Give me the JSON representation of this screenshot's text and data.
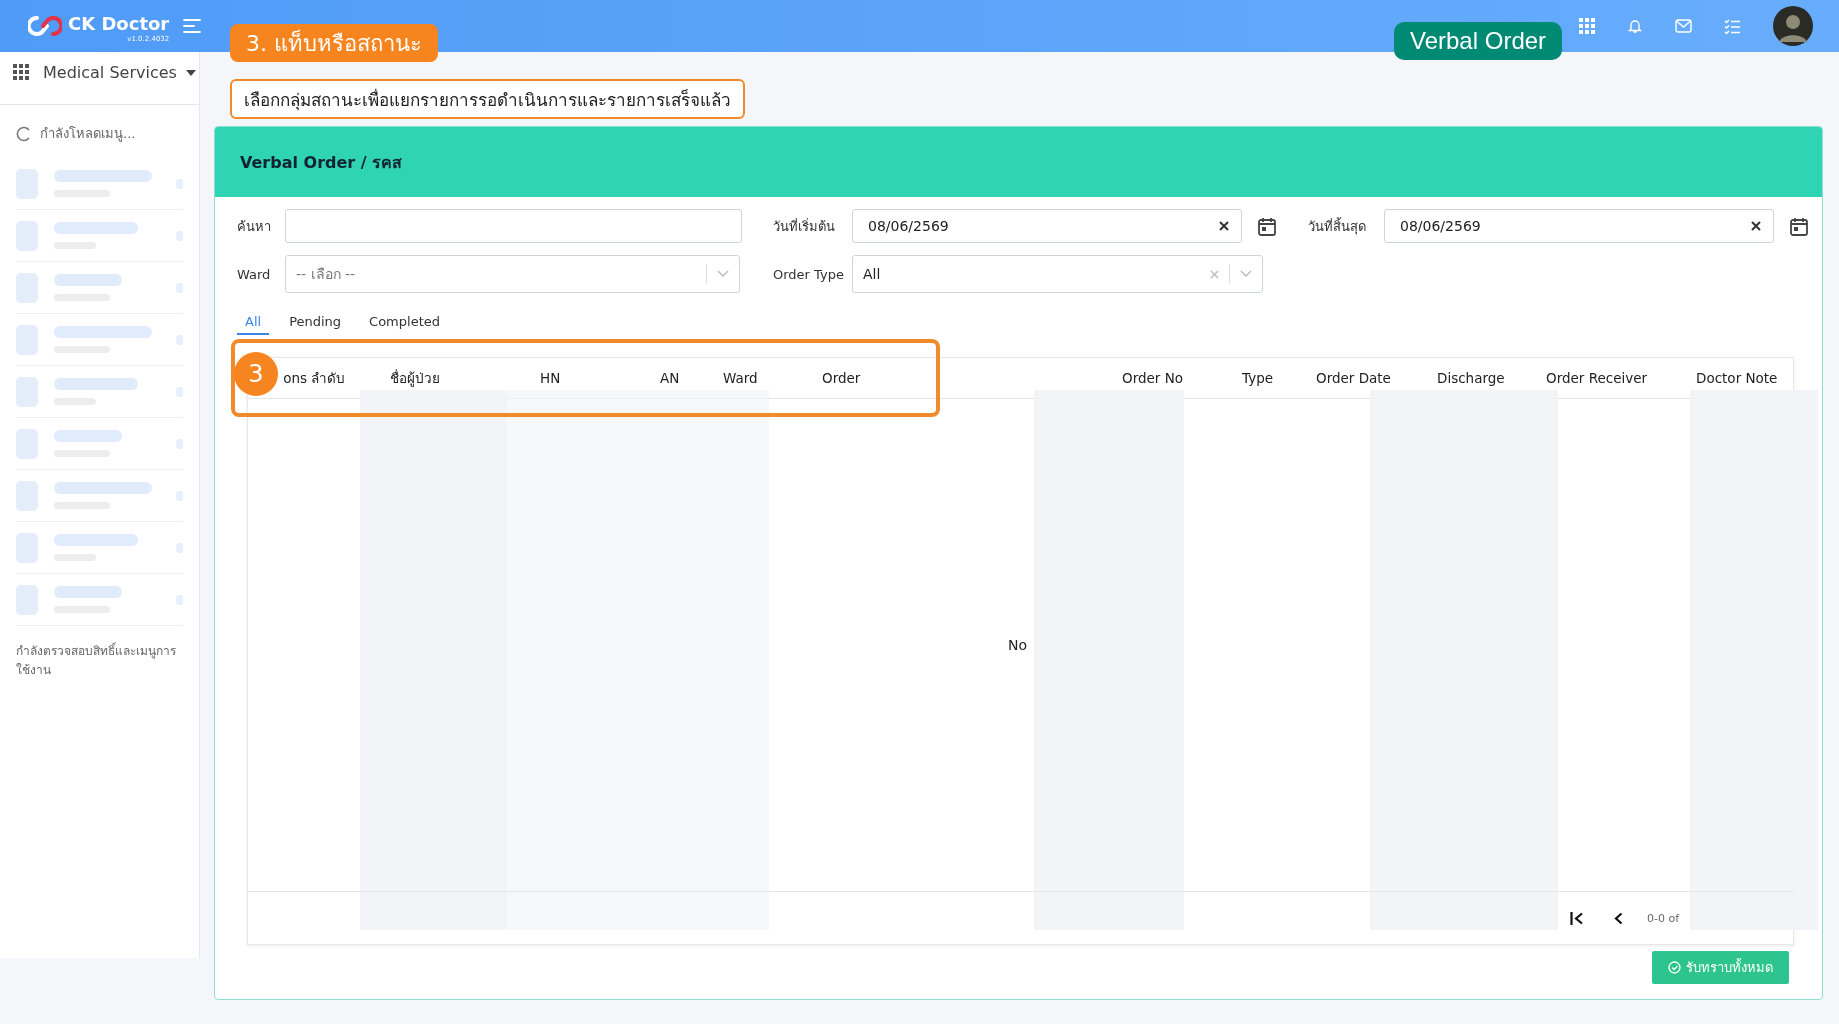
{
  "app": {
    "name": "CK Doctor",
    "version": "v1.0.2.4032"
  },
  "sidebar": {
    "module": "Medical Services",
    "loading_text": "กำลังโหลดเมนู...",
    "footer_text": "กำลังตรวจสอบสิทธิ์และเมนูการใช้งาน"
  },
  "annotations": {
    "step_label": "3. แท็บหรือสถานะ",
    "description": "เลือกกลุ่มสถานะเพื่อแยกรายการรอดำเนินการและรายการเสร็จแล้ว",
    "tag": "Verbal Order",
    "badge": "3"
  },
  "panel": {
    "title": "Verbal Order / รคส"
  },
  "filters": [
    {
      "label": "ค้นหา",
      "kind": "text"
    },
    {
      "label": "วันที่เริ่มต้น",
      "kind": "date",
      "value": "08/06/2569"
    },
    {
      "label": "วันที่สิ้นสุด",
      "kind": "date",
      "value": "08/06/2569"
    },
    {
      "label": "Ward",
      "kind": "select",
      "placeholder": "-- เลือก --",
      "clearable": false
    },
    {
      "label": "Order Type",
      "kind": "select",
      "value": "All",
      "clearable": true
    }
  ],
  "tabs": [
    {
      "label": "All",
      "selected": true
    },
    {
      "label": "Pending",
      "selected": false
    },
    {
      "label": "Completed",
      "selected": false
    }
  ],
  "table": {
    "columns": [
      "ons",
      "ลำดับ",
      "ชื่อผู้ป่วย",
      "HN",
      "AN",
      "Ward",
      "Order",
      "Order No",
      "Type",
      "Order Date",
      "Discharge",
      "Order Receiver",
      "Doctor Note"
    ],
    "empty_text": "No",
    "pagination": "0-0 of"
  },
  "confirm_button": "รับทราบทั้งหมด"
}
